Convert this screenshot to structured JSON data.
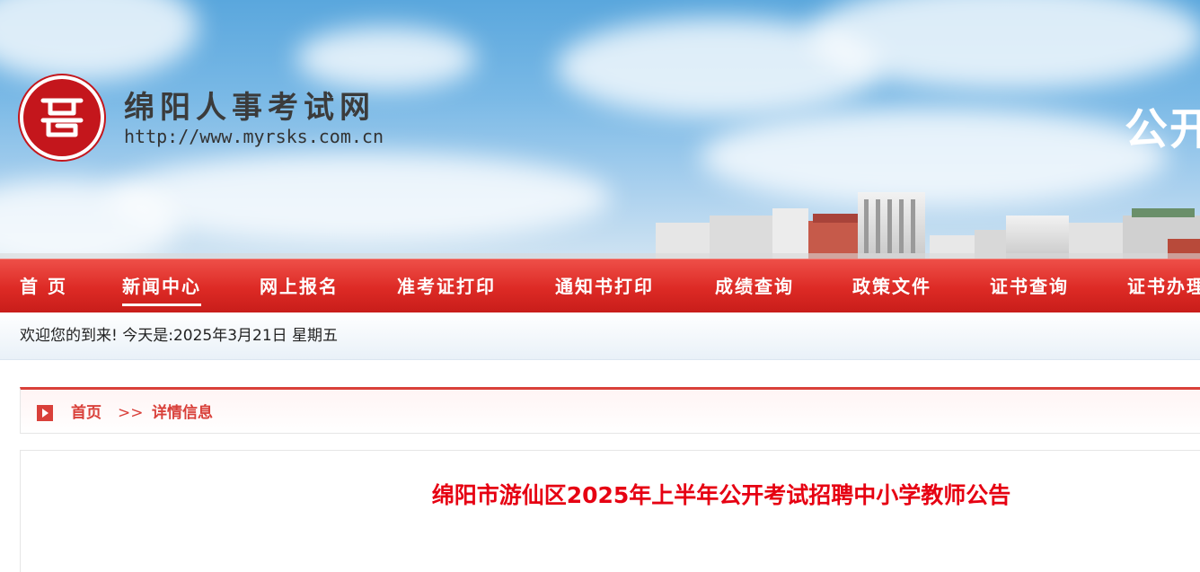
{
  "header": {
    "site_name": "绵阳人事考试网",
    "site_url": "http://www.myrsks.com.cn",
    "slogan": "公开"
  },
  "nav": {
    "items": [
      {
        "label": "首 页"
      },
      {
        "label": "新闻中心",
        "active": true
      },
      {
        "label": "网上报名"
      },
      {
        "label": "准考证打印"
      },
      {
        "label": "通知书打印"
      },
      {
        "label": "成绩查询"
      },
      {
        "label": "政策文件"
      },
      {
        "label": "证书查询"
      },
      {
        "label": "证书办理"
      }
    ]
  },
  "welcome": {
    "text": "欢迎您的到来!  今天是:2025年3月21日 星期五"
  },
  "breadcrumb": {
    "home": "首页",
    "separator": ">>",
    "current": "详情信息"
  },
  "article": {
    "title": "绵阳市游仙区2025年上半年公开考试招聘中小学教师公告"
  },
  "colors": {
    "nav_red": "#dd2a25",
    "title_red": "#e60012",
    "crumb_red": "#d9403a"
  }
}
